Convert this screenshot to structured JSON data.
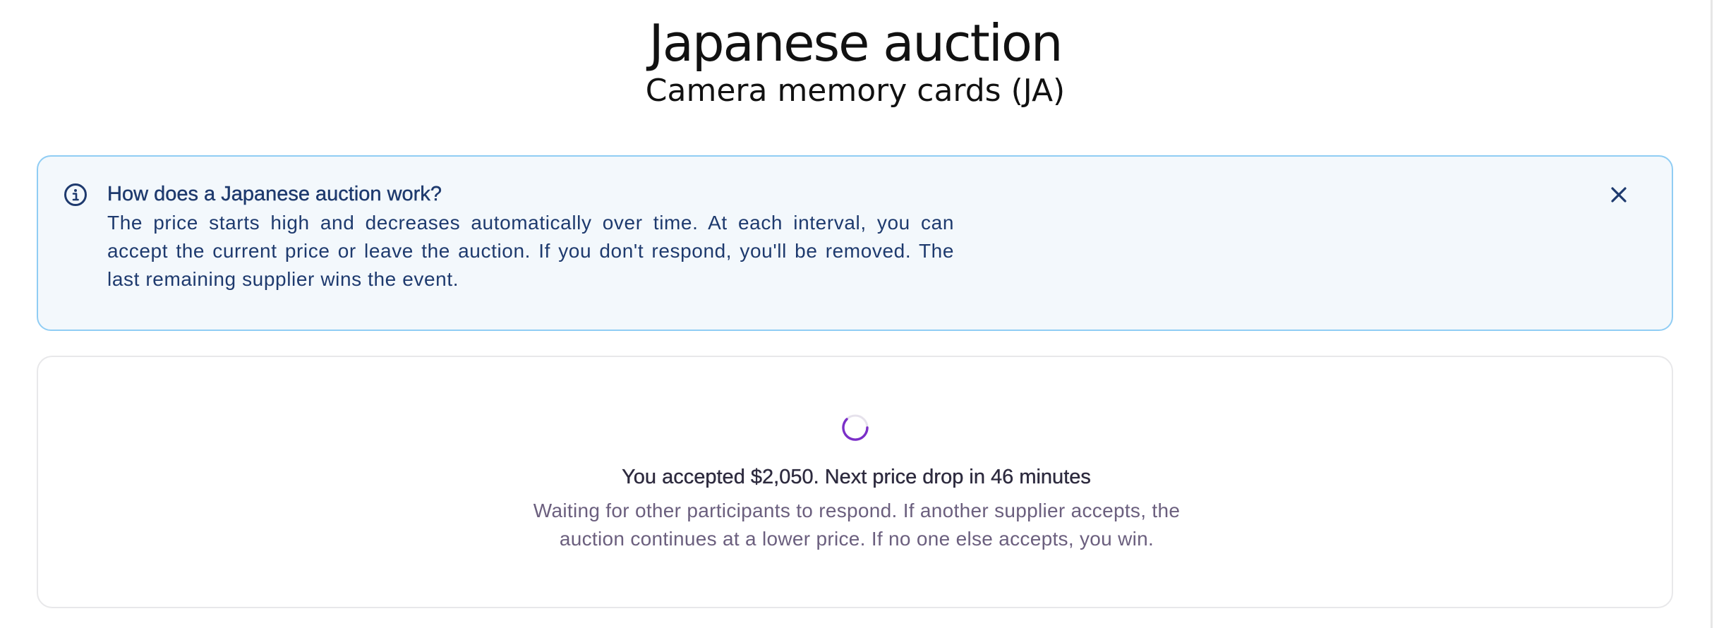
{
  "header": {
    "title": "Japanese auction",
    "subtitle": "Camera memory cards (JA)"
  },
  "info_panel": {
    "icon": "info-circle-icon",
    "title": "How does a Japanese auction work?",
    "body": "The price starts high and decreases automatically over time. At each interval, you can accept the current price or leave the auction. If you don't respond, you'll be removed. The last remaining supplier wins the event.",
    "dismiss_icon": "close-icon"
  },
  "status_card": {
    "icon": "loading-spinner-icon",
    "headline": "You accepted $2,050. Next price drop in 46 minutes",
    "description": "Waiting for other participants to respond. If another supplier accepts, the auction continues at a lower price. If no one else accepts, you win."
  },
  "colors": {
    "info_border": "#90cdf4",
    "info_background": "#f3f8fc",
    "info_text": "#1e3a6e",
    "spinner_accent": "#7b2fc8",
    "card_border": "#e8e8ea",
    "muted_text": "#6b5f7e"
  }
}
